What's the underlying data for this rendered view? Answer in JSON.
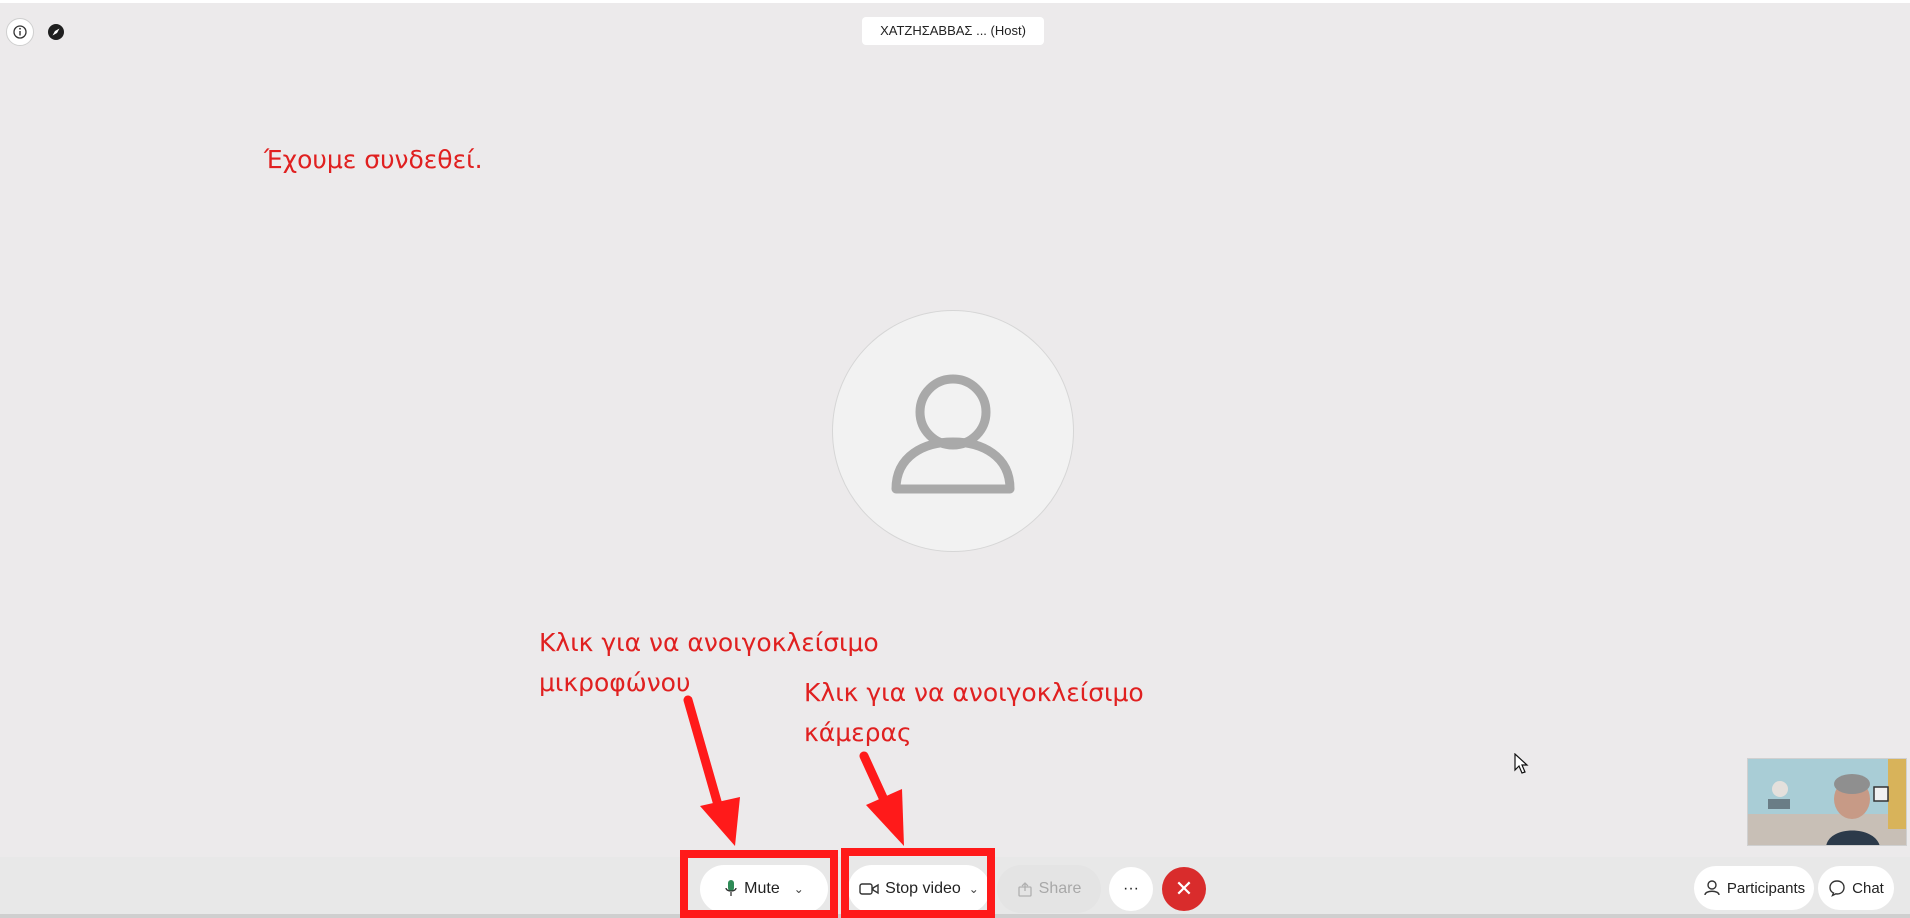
{
  "meeting": {
    "title": "ΧΑΤΖΗΣΑΒΒΑΣ ... (Host)"
  },
  "annotations": {
    "connected": "Έχουμε συνδεθεί.",
    "mic_line1": "Κλικ για να ανοιγοκλείσιμο",
    "mic_line2": "μικροφώνου",
    "cam_line1": "Κλικ για να ανοιγοκλείσιμο",
    "cam_line2": "κάμερας"
  },
  "toolbar": {
    "mute_label": "Mute",
    "stop_video_label": "Stop video",
    "share_label": "Share",
    "more_label": "···",
    "end_label": "✕"
  },
  "right_panel": {
    "participants_label": "Participants",
    "chat_label": "Chat"
  },
  "icons": {
    "info": "info-icon",
    "compass": "compass-icon",
    "avatar": "person-icon",
    "mic": "microphone-icon",
    "camera": "camera-icon",
    "share": "share-icon",
    "more": "more-icon",
    "end": "close-icon",
    "participants": "person-icon",
    "chat": "chat-bubble-icon"
  },
  "colors": {
    "background": "#eceaeb",
    "annotation": "#e02020",
    "end_button": "#d92c2c",
    "mic_icon": "#2e8b57"
  }
}
